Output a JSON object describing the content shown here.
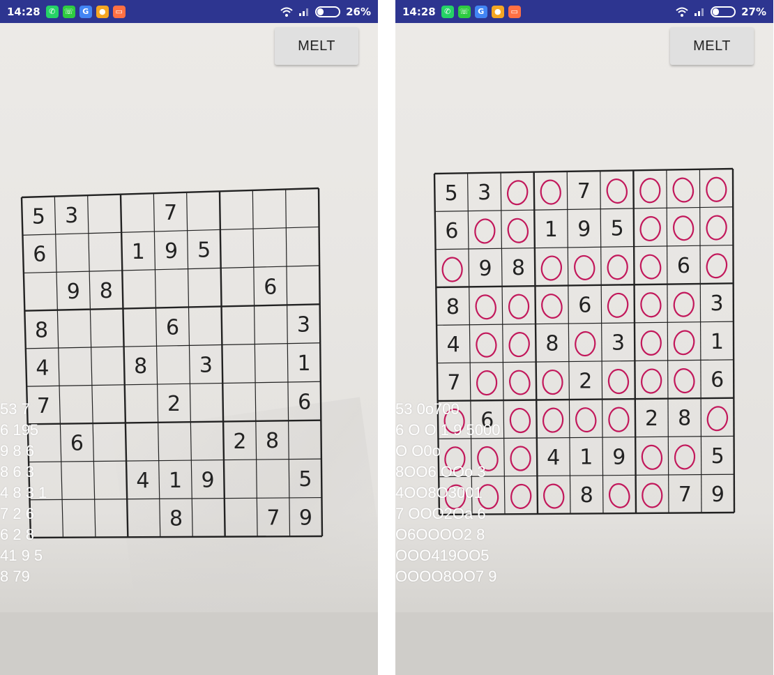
{
  "colors": {
    "statusbar": "#2d3590",
    "circle_mark": "#c2185b",
    "grid_ink": "#222222"
  },
  "left": {
    "status": {
      "time": "14:28",
      "battery": "26%"
    },
    "melt_label": "MELT",
    "grid": [
      [
        "5",
        "3",
        "",
        "",
        "7",
        "",
        "",
        "",
        ""
      ],
      [
        "6",
        "",
        "",
        "1",
        "9",
        "5",
        "",
        "",
        ""
      ],
      [
        "",
        "9",
        "8",
        "",
        "",
        "",
        "",
        "6",
        ""
      ],
      [
        "8",
        "",
        "",
        "",
        "6",
        "",
        "",
        "",
        "3"
      ],
      [
        "4",
        "",
        "",
        "8",
        "",
        "3",
        "",
        "",
        "1"
      ],
      [
        "7",
        "",
        "",
        "",
        "2",
        "",
        "",
        "",
        "6"
      ],
      [
        "",
        "6",
        "",
        "",
        "",
        "",
        "2",
        "8",
        ""
      ],
      [
        "",
        "",
        "",
        "4",
        "1",
        "9",
        "",
        "",
        "5"
      ],
      [
        "",
        "",
        "",
        "",
        "8",
        "",
        "",
        "7",
        "9"
      ]
    ],
    "ocr_lines": [
      "53 7",
      "6 195",
      "9 8 6",
      "8 6 3",
      "4 8 3 1",
      "7 2 6",
      "6 2 8",
      "41 9 5",
      "8 79"
    ]
  },
  "right": {
    "status": {
      "time": "14:28",
      "battery": "27%"
    },
    "melt_label": "MELT",
    "grid": [
      [
        "5",
        "3",
        "",
        "",
        "7",
        "",
        "",
        "",
        ""
      ],
      [
        "6",
        "",
        "",
        "1",
        "9",
        "5",
        "",
        "",
        ""
      ],
      [
        "",
        "9",
        "8",
        "",
        "",
        "",
        "",
        "6",
        ""
      ],
      [
        "8",
        "",
        "",
        "",
        "6",
        "",
        "",
        "",
        "3"
      ],
      [
        "4",
        "",
        "",
        "8",
        "",
        "3",
        "",
        "",
        "1"
      ],
      [
        "7",
        "",
        "",
        "",
        "2",
        "",
        "",
        "",
        "6"
      ],
      [
        "",
        "6",
        "",
        "",
        "",
        "",
        "2",
        "8",
        ""
      ],
      [
        "",
        "",
        "",
        "4",
        "1",
        "9",
        "",
        "",
        "5"
      ],
      [
        "",
        "",
        "",
        "",
        "8",
        "",
        "",
        "7",
        "9"
      ]
    ],
    "ocr_lines": [
      "53 0o700",
      "6 O O 1 9 5000",
      "O O0o",
      "8OO6 OOo 3",
      "4OO8O3001",
      "7 OOO2Oa 6",
      "O6OOOO2 8",
      "OOO419OO5",
      "OOOO8OO7 9"
    ]
  }
}
